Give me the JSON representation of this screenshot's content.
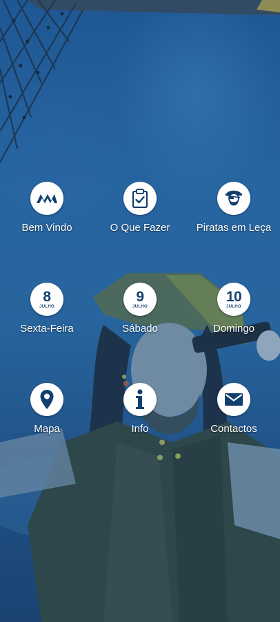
{
  "menu": {
    "row1": [
      {
        "label": "Bem Vindo",
        "icon": "logo-icon"
      },
      {
        "label": "O Que Fazer",
        "icon": "clipboard-check-icon"
      },
      {
        "label": "Piratas em Leça",
        "icon": "pirate-icon"
      }
    ],
    "row2": [
      {
        "label": "Sexta-Feira",
        "day": "8",
        "month": "JULHO"
      },
      {
        "label": "Sábado",
        "day": "9",
        "month": "JULHO"
      },
      {
        "label": "Domingo",
        "day": "10",
        "month": "JULHO"
      }
    ],
    "row3": [
      {
        "label": "Mapa",
        "icon": "map-pin-icon"
      },
      {
        "label": "Info",
        "icon": "info-icon"
      },
      {
        "label": "Contactos",
        "icon": "envelope-icon"
      }
    ]
  },
  "colors": {
    "icon_color": "#11406f",
    "circle_bg": "#ffffff",
    "label_color": "#ffffff",
    "background_blue": "#2a6aa5"
  }
}
